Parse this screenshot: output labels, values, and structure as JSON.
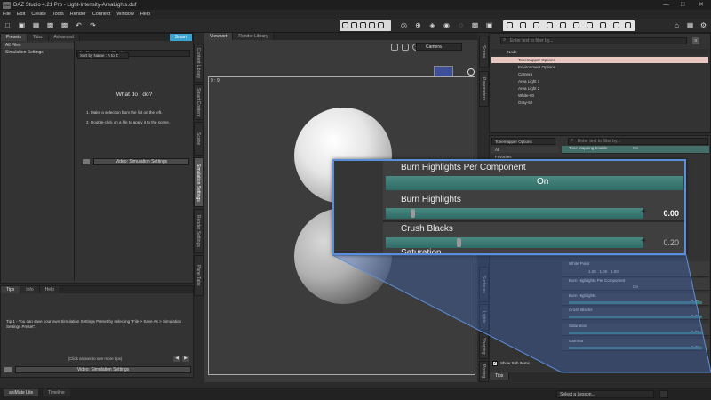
{
  "window": {
    "app_icon": "DAZ",
    "title": "DAZ Studio 4.21 Pro - Light-Intensity-AreaLights.duf",
    "controls": [
      "—",
      "□",
      "✕"
    ]
  },
  "menu": [
    "File",
    "Edit",
    "Create",
    "Tools",
    "Render",
    "Connect",
    "Window",
    "Help"
  ],
  "left_panel": {
    "tabs": [
      "Presets",
      "Tabs",
      "Advanced"
    ],
    "highlight_tab": "Smart",
    "filter_placeholder": "Enter text to filter by...",
    "tree": [
      "All Files",
      "Simulation Settings"
    ],
    "sort_label": "Sort by Name : A to Z",
    "what_title": "What do I do?",
    "step1": "1. Make a selection from the list on the left.",
    "step2": "2. Double-click on a file to apply it to the scene.",
    "video_button": "Video: Simulation Settings",
    "vtabs": [
      "Content Library",
      "Smart Content",
      "Scene",
      "Simulation Settings",
      "Render Settings",
      "Pane Tabs"
    ]
  },
  "tips_panel": {
    "tabs": [
      "Tips",
      "Info",
      "Help"
    ],
    "tip": "Tip 1 - You can save your own Simulation Settings Preset by selecting \"File > Save As > Simulation Settings Preset\".",
    "nav_hint": "(Click arrows to see more tips)",
    "video_button": "Video: Simulation Settings"
  },
  "viewport": {
    "tabs": [
      "Viewport",
      "Render Library"
    ],
    "camera_select": "Camera",
    "aspect_label": "9 : 9"
  },
  "right_panel": {
    "search_placeholder": "Enter text to filter by...",
    "node_header": "Node",
    "scene_items": [
      "Tonemapper Options",
      "Environment Options",
      "Camera",
      "Area Light 1",
      "Area Light 2",
      "White-90",
      "Gray-50"
    ],
    "side_tabs": [
      "Scene",
      "Parameters",
      "Surfaces",
      "Lights",
      "Shaping",
      "Posing"
    ],
    "dropdown": "Tonemapper Options",
    "filter_placeholder": "Enter text to filter by...",
    "categories": [
      "All",
      "Favorites"
    ],
    "params": [
      {
        "label": "Tone Mapping Enable",
        "value": "On"
      },
      {
        "label": "White Point",
        "value": "1.00   1.00   1.00"
      },
      {
        "label": "Burn Highlights Per Component",
        "value": "On"
      },
      {
        "label": "Burn Highlights",
        "value": "0.00"
      },
      {
        "label": "Crush Blacks",
        "value": "0.20"
      },
      {
        "label": "Saturation",
        "value": "1.00"
      },
      {
        "label": "Gamma",
        "value": "2.20"
      }
    ],
    "show_sub_items": "Show Sub Items",
    "bottom_tab": "Tips"
  },
  "zoom": {
    "rows": [
      {
        "label": "Burn Highlights Per Component",
        "value": "On",
        "level": 1.0
      },
      {
        "label": "Burn Highlights",
        "value": "0.00",
        "level": 0.0
      },
      {
        "label": "Crush Blacks",
        "value": "0.20",
        "level": 0.2
      },
      {
        "label": "Saturation",
        "value": "",
        "level": 0
      }
    ]
  },
  "status": {
    "tabs": [
      "aniMate Lite",
      "Timeline"
    ],
    "lesson_select": "Select a Lesson..."
  },
  "colors": {
    "accent": "#5b8fd9",
    "slider_fill": "#3c7a74",
    "selected_row": "#e8c8c0"
  }
}
